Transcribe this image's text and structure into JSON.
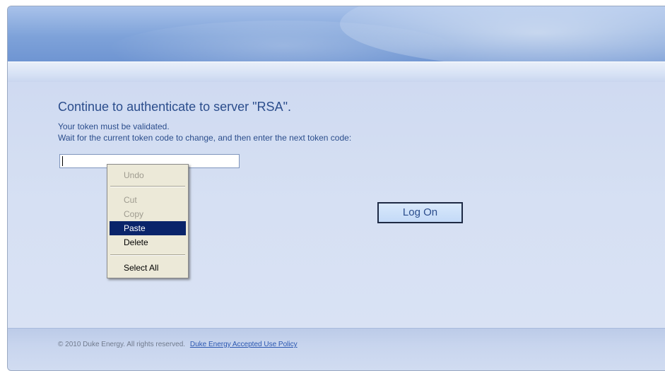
{
  "auth": {
    "heading": "Continue to authenticate to server \"RSA\".",
    "message_line1": "Your token must be validated.",
    "message_line2": "Wait for the current token code to change, and then enter the next token code:",
    "token_value": "",
    "logon_label": "Log On"
  },
  "context_menu": {
    "items": [
      {
        "label": "Undo",
        "enabled": false
      },
      {
        "label": "Cut",
        "enabled": false
      },
      {
        "label": "Copy",
        "enabled": false
      },
      {
        "label": "Paste",
        "enabled": true,
        "selected": true
      },
      {
        "label": "Delete",
        "enabled": true
      },
      {
        "label": "Select All",
        "enabled": true
      }
    ],
    "highlight_color": "#0a246a"
  },
  "footer": {
    "copyright": "© 2010 Duke Energy. All rights reserved.",
    "policy_link": "Duke Energy Accepted Use Policy"
  },
  "colors": {
    "text_blue": "#2b4d8c",
    "link_blue": "#2a56b0",
    "header_blue": "#7ea2d9"
  }
}
